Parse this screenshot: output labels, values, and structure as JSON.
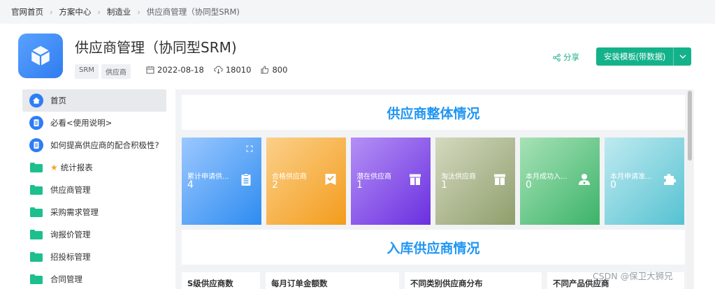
{
  "breadcrumb": [
    "官网首页",
    "方案中心",
    "制造业",
    "供应商管理（协同型SRM)"
  ],
  "header": {
    "title": "供应商管理（协同型SRM)",
    "tags": [
      "SRM",
      "供应商"
    ],
    "date": "2022-08-18",
    "downloads": "18010",
    "likes": "800",
    "share_label": "分享",
    "install_label": "安装模板(带数据)"
  },
  "sidebar": {
    "items": [
      {
        "label": "首页",
        "icon": "home-icon",
        "active": true
      },
      {
        "label": "必看<使用说明>",
        "icon": "document-icon"
      },
      {
        "label": "如何提高供应商的配合积极性?",
        "icon": "document-icon"
      },
      {
        "label": "统计报表",
        "icon": "folder-icon",
        "star": true
      },
      {
        "label": "供应商管理",
        "icon": "folder-icon"
      },
      {
        "label": "采购需求管理",
        "icon": "folder-icon"
      },
      {
        "label": "询报价管理",
        "icon": "folder-icon"
      },
      {
        "label": "招投标管理",
        "icon": "folder-icon"
      },
      {
        "label": "合同管理",
        "icon": "folder-icon"
      }
    ]
  },
  "dashboard": {
    "section1_title": "供应商整体情况",
    "section2_title": "入库供应商情况",
    "cards": [
      {
        "label": "累计申请供...",
        "value": "4",
        "icon": "clipboard-icon"
      },
      {
        "label": "合格供应商",
        "value": "2",
        "icon": "check-flag-icon"
      },
      {
        "label": "潜在供应商",
        "value": "1",
        "icon": "gift-icon"
      },
      {
        "label": "淘汰供应商",
        "value": "1",
        "icon": "gift-icon"
      },
      {
        "label": "本月成功入...",
        "value": "0",
        "icon": "user-icon"
      },
      {
        "label": "本月申请准...",
        "value": "0",
        "icon": "puzzle-icon"
      }
    ],
    "bottom_titles": [
      "S级供应商数",
      "每月订单金额数",
      "不同类别供应商分布",
      "不同产品供应商"
    ]
  },
  "watermark": "CSDN @保卫大狮兄",
  "colors": {
    "accent": "#2196f3",
    "install_green": "#13b28a",
    "share_green": "#1aab8a"
  }
}
